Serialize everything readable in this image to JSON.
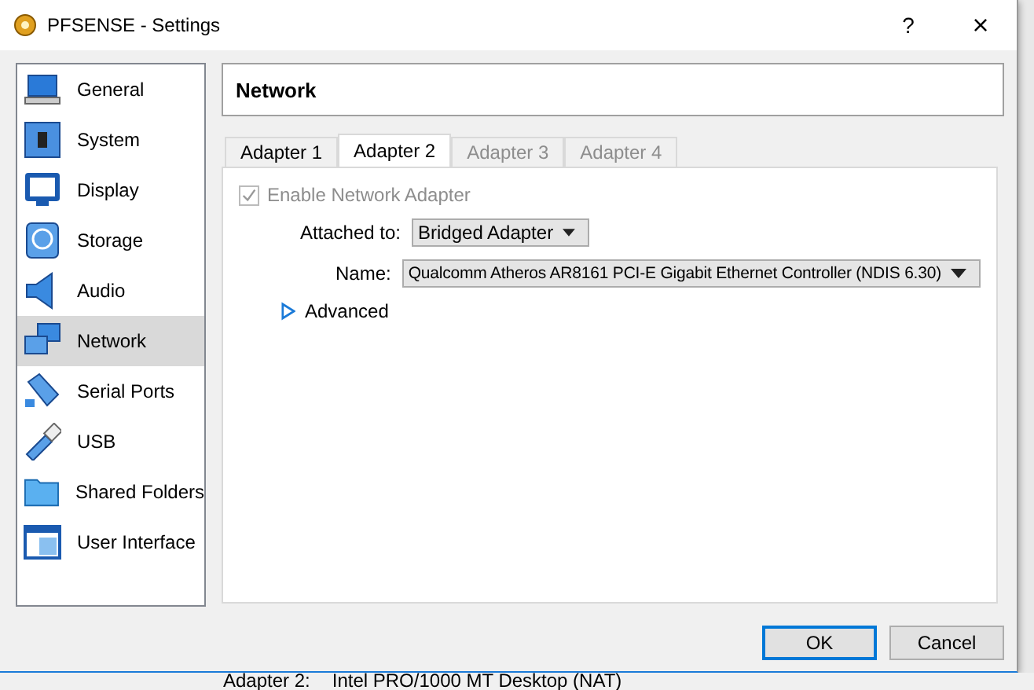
{
  "window": {
    "title": "PFSENSE - Settings",
    "help": "?",
    "close": "×"
  },
  "sidebar": {
    "items": [
      {
        "label": "General",
        "kind": "general",
        "selected": false
      },
      {
        "label": "System",
        "kind": "system",
        "selected": false
      },
      {
        "label": "Display",
        "kind": "display",
        "selected": false
      },
      {
        "label": "Storage",
        "kind": "storage",
        "selected": false
      },
      {
        "label": "Audio",
        "kind": "audio",
        "selected": false
      },
      {
        "label": "Network",
        "kind": "network",
        "selected": true
      },
      {
        "label": "Serial Ports",
        "kind": "serial",
        "selected": false
      },
      {
        "label": "USB",
        "kind": "usb",
        "selected": false
      },
      {
        "label": "Shared Folders",
        "kind": "folder",
        "selected": false
      },
      {
        "label": "User Interface",
        "kind": "ui",
        "selected": false
      }
    ]
  },
  "page_title": "Network",
  "tabs": [
    {
      "label": "Adapter 1",
      "selected": false,
      "disabled": false
    },
    {
      "label": "Adapter 2",
      "selected": true,
      "disabled": false
    },
    {
      "label": "Adapter 3",
      "selected": false,
      "disabled": true
    },
    {
      "label": "Adapter 4",
      "selected": false,
      "disabled": true
    }
  ],
  "enable_adapter": {
    "label": "Enable Network Adapter",
    "checked": true,
    "disabled": true
  },
  "attached_to": {
    "label": "Attached to:",
    "value": "Bridged Adapter"
  },
  "name": {
    "label": "Name:",
    "value": "Qualcomm Atheros AR8161 PCI-E Gigabit Ethernet Controller (NDIS 6.30)"
  },
  "advanced": {
    "label": "Advanced",
    "expanded": false
  },
  "buttons": [
    {
      "label": "OK",
      "default": true
    },
    {
      "label": "Cancel",
      "default": false
    }
  ],
  "background_window": {
    "label": "Adapter 2:",
    "value": "Intel PRO/1000 MT Desktop (NAT)"
  }
}
